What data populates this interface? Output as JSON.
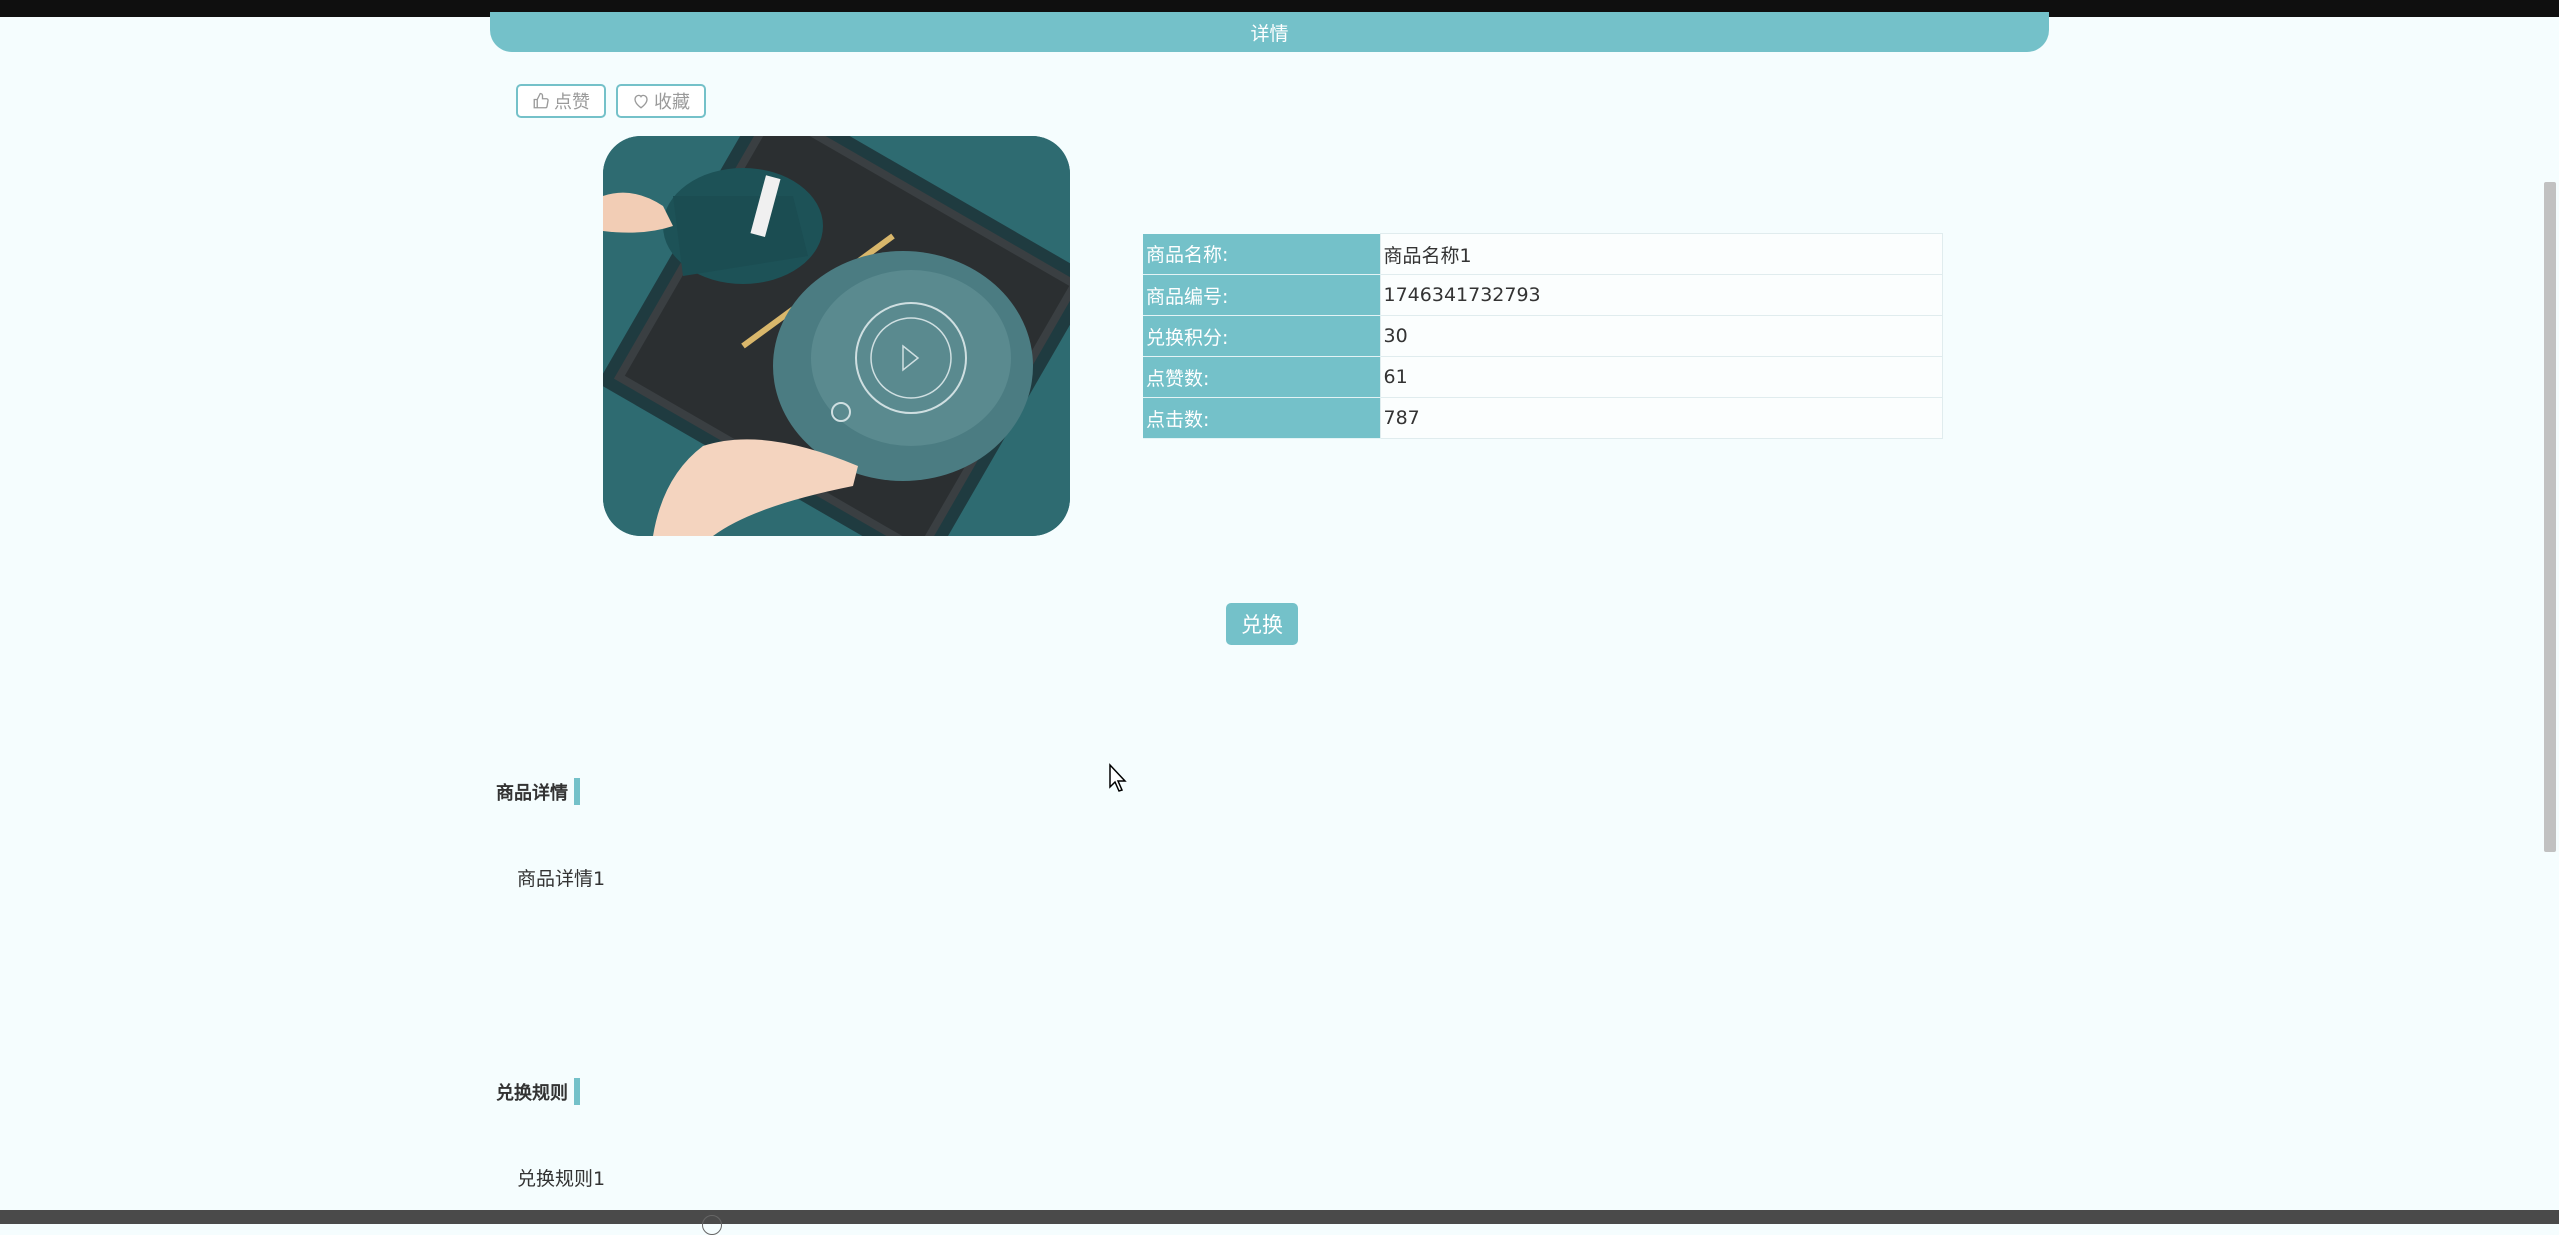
{
  "header": {
    "title": "详情"
  },
  "actions": {
    "like_label": "点赞",
    "favorite_label": "收藏"
  },
  "product": {
    "image_icon": "product-photo",
    "fields": [
      {
        "label": "商品名称:",
        "value": "商品名称1"
      },
      {
        "label": "商品编号:",
        "value": "1746341732793"
      },
      {
        "label": "兑换积分:",
        "value": "30"
      },
      {
        "label": "点赞数:",
        "value": "61"
      },
      {
        "label": "点击数:",
        "value": "787"
      }
    ]
  },
  "exchange_button": {
    "label": "兑换"
  },
  "details_section": {
    "title": "商品详情",
    "content": "商品详情1"
  },
  "rules_section": {
    "title": "兑换规则",
    "content": "兑换规则1"
  },
  "colors": {
    "accent": "#74c1c9",
    "background": "#f5fdfe"
  }
}
